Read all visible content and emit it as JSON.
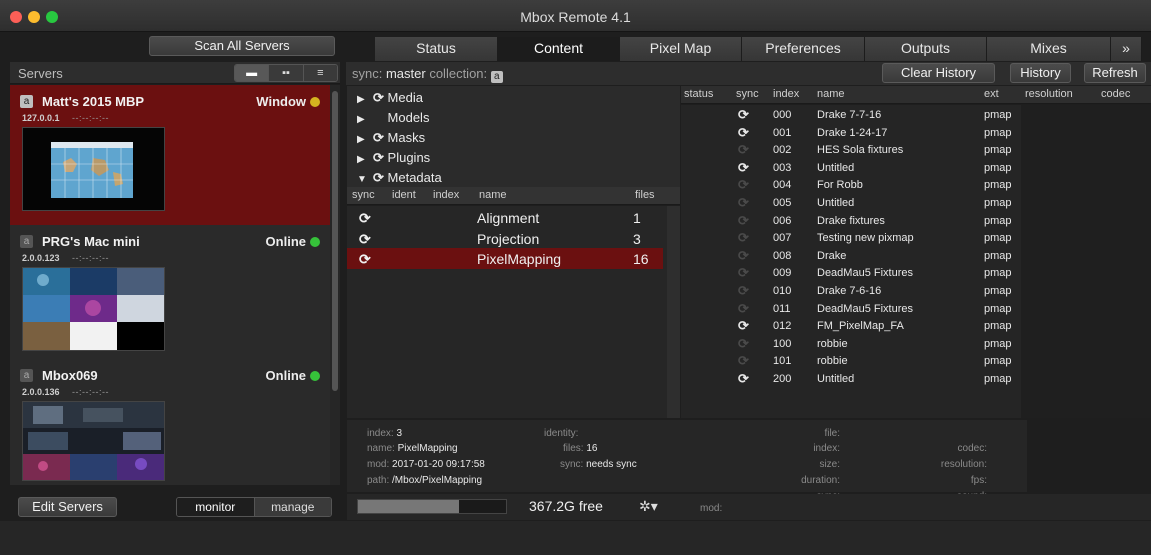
{
  "window": {
    "title": "Mbox Remote 4.1"
  },
  "left": {
    "scan_button": "Scan All Servers",
    "servers_title": "Servers",
    "view_buttons": [
      "▬",
      "▪▪",
      "≡"
    ],
    "edit_button": "Edit Servers",
    "mode_tabs": [
      "monitor",
      "manage"
    ],
    "servers": [
      {
        "badge": "a",
        "name": "Matt's 2015 MBP",
        "ip": "127.0.0.1",
        "dashes": "--:--:--:--",
        "status": "Window",
        "status_color": "#d4b320"
      },
      {
        "badge": "a",
        "name": "PRG's Mac mini",
        "ip": "2.0.0.123",
        "dashes": "--:--:--:--",
        "status": "Online",
        "status_color": "#36c23a"
      },
      {
        "badge": "a",
        "name": "Mbox069",
        "ip": "2.0.0.136",
        "dashes": "--:--:--:--",
        "status": "Online",
        "status_color": "#36c23a"
      }
    ]
  },
  "tabs": [
    "Status",
    "Content",
    "Pixel Map",
    "Preferences",
    "Outputs",
    "Mixes",
    "»"
  ],
  "toolbar": {
    "sync_prefix": "sync:",
    "sync_value": "master",
    "collection_label": "collection:",
    "collection_badge": "a",
    "clear_history": "Clear History",
    "history": "History",
    "refresh": "Refresh"
  },
  "tree": [
    {
      "arrow": "▶",
      "label": "Media",
      "sync": true
    },
    {
      "arrow": "▶",
      "label": "Models",
      "sync": false
    },
    {
      "arrow": "▶",
      "label": "Masks",
      "sync": true
    },
    {
      "arrow": "▶",
      "label": "Plugins",
      "sync": true
    },
    {
      "arrow": "▼",
      "label": "Metadata",
      "sync": true
    }
  ],
  "collection_table": {
    "headers": [
      "sync",
      "ident",
      "index",
      "name",
      "files"
    ],
    "rows": [
      {
        "name": "Alignment",
        "files": "1"
      },
      {
        "name": "Projection",
        "files": "3"
      },
      {
        "name": "PixelMapping",
        "files": "16"
      }
    ]
  },
  "file_list": {
    "headers": [
      "status",
      "sync",
      "index",
      "name",
      "ext",
      "resolution",
      "codec"
    ],
    "rows": [
      {
        "sync": true,
        "index": "000",
        "name": "Drake 7-7-16",
        "ext": "pmap"
      },
      {
        "sync": true,
        "index": "001",
        "name": "Drake 1-24-17",
        "ext": "pmap"
      },
      {
        "sync": false,
        "index": "002",
        "name": "HES Sola fixtures",
        "ext": "pmap"
      },
      {
        "sync": true,
        "index": "003",
        "name": "Untitled",
        "ext": "pmap"
      },
      {
        "sync": false,
        "index": "004",
        "name": "For Robb",
        "ext": "pmap"
      },
      {
        "sync": false,
        "index": "005",
        "name": "Untitled",
        "ext": "pmap"
      },
      {
        "sync": false,
        "index": "006",
        "name": "Drake fixtures",
        "ext": "pmap"
      },
      {
        "sync": false,
        "index": "007",
        "name": "Testing new pixmap",
        "ext": "pmap"
      },
      {
        "sync": false,
        "index": "008",
        "name": "Drake",
        "ext": "pmap"
      },
      {
        "sync": false,
        "index": "009",
        "name": "DeadMau5 Fixtures",
        "ext": "pmap"
      },
      {
        "sync": false,
        "index": "010",
        "name": "Drake 7-6-16",
        "ext": "pmap"
      },
      {
        "sync": false,
        "index": "011",
        "name": "DeadMau5 Fixtures",
        "ext": "pmap"
      },
      {
        "sync": true,
        "index": "012",
        "name": "FM_PixelMap_FA",
        "ext": "pmap"
      },
      {
        "sync": false,
        "index": "100",
        "name": "robbie",
        "ext": "pmap"
      },
      {
        "sync": false,
        "index": "101",
        "name": "robbie",
        "ext": "pmap"
      },
      {
        "sync": true,
        "index": "200",
        "name": "Untitled",
        "ext": "pmap"
      }
    ]
  },
  "info": {
    "index_key": "index:",
    "index_val": "3",
    "name_key": "name:",
    "name_val": "PixelMapping",
    "mod_key": "mod:",
    "mod_val": "2017-01-20 09:17:58",
    "path_key": "path:",
    "path_val": "/Mbox/PixelMapping",
    "identity_key": "identity:",
    "files_key": "files:",
    "files_val": "16",
    "sync_key": "sync:",
    "sync_val": "needs sync",
    "file_key": "file:",
    "findex_key": "index:",
    "size_key": "size:",
    "duration_key": "duration:",
    "fsync_key": "sync:",
    "codec_key": "codec:",
    "resolution_key": "resolution:",
    "fps_key": "fps:",
    "sound_key": "sound:"
  },
  "bottom": {
    "disk_used_fraction": 0.68,
    "free_text": "367.2G free",
    "gear": "✲▾",
    "mod_label": "mod:"
  }
}
